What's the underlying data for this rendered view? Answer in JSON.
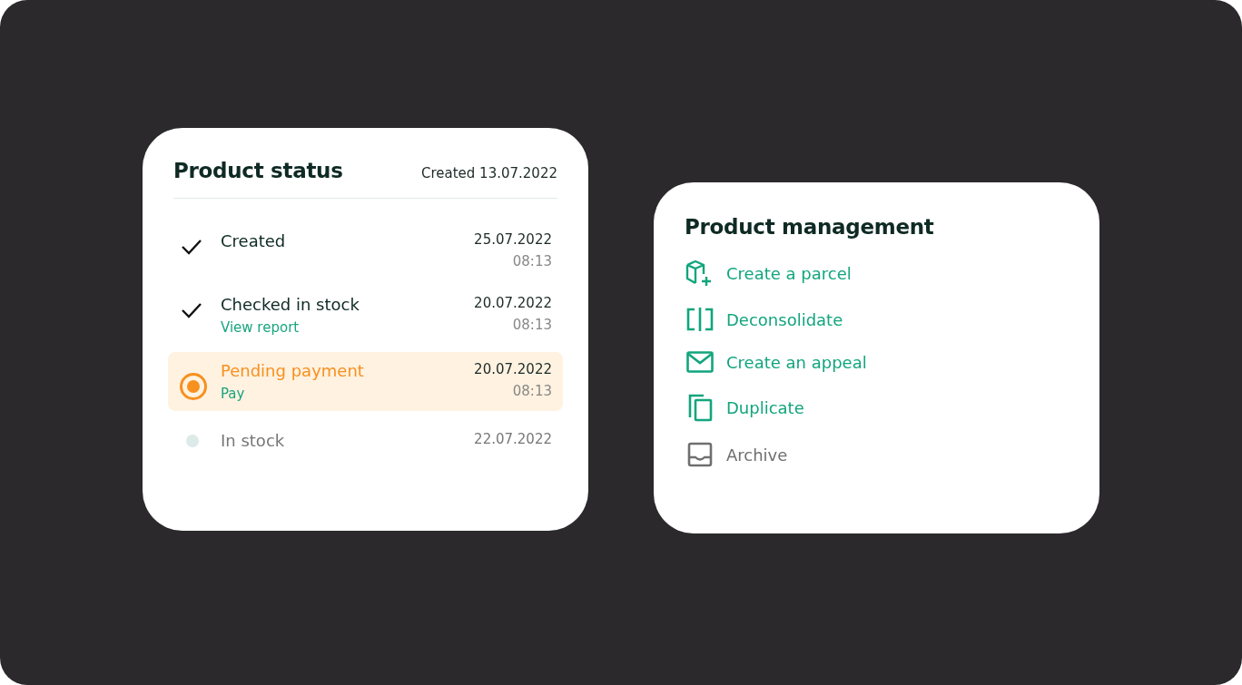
{
  "status_card": {
    "title": "Product status",
    "created": "Created 13.07.2022",
    "steps": [
      {
        "kind": "done",
        "label": "Created",
        "date": "25.07.2022",
        "time": "08:13"
      },
      {
        "kind": "done",
        "label": "Checked in stock",
        "link": "View report",
        "date": "20.07.2022",
        "time": "08:13"
      },
      {
        "kind": "current",
        "label": "Pending payment",
        "link": "Pay",
        "date": "20.07.2022",
        "time": "08:13"
      },
      {
        "kind": "pending",
        "label": "In stock",
        "date": "22.07.2022"
      }
    ]
  },
  "management_card": {
    "title": "Product management",
    "actions": [
      {
        "kind": "parcel",
        "label": "Create a parcel",
        "disabled": false
      },
      {
        "kind": "split",
        "label": "Deconsolidate",
        "disabled": false
      },
      {
        "kind": "mail",
        "label": "Create an appeal",
        "disabled": false
      },
      {
        "kind": "copy",
        "label": "Duplicate",
        "disabled": false
      },
      {
        "kind": "archive",
        "label": "Archive",
        "disabled": true
      }
    ]
  }
}
